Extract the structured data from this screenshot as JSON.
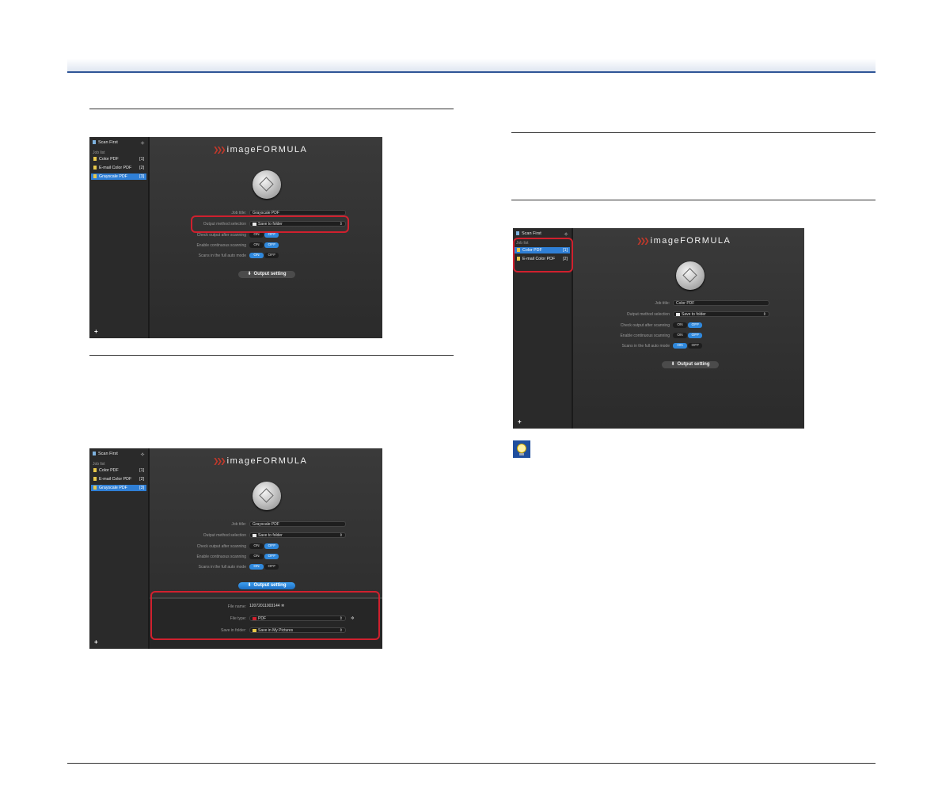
{
  "shots": [
    {
      "id": "s1",
      "scan_first": "Scan First",
      "job_list_caption": "Job list",
      "jobs": [
        {
          "label": "Color PDF",
          "num": "[1]",
          "selected": false
        },
        {
          "label": "E-mail Color PDF",
          "num": "[2]",
          "selected": false
        },
        {
          "label": "Grayscale PDF",
          "num": "[3]",
          "selected": true
        }
      ],
      "logo": "imageFORMULA",
      "job_title_label": "Job title:",
      "job_title_value": "Grayscale PDF",
      "output_method_label": "Output method selection",
      "output_method_value": "Save to folder",
      "check_output_label": "Check output after scanning",
      "continuous_label": "Enable continuous scanning",
      "full_auto_label": "Scans in the full auto mode",
      "on": "ON",
      "off": "OFF",
      "output_setting": "Output setting"
    },
    {
      "id": "s2",
      "scan_first": "Scan First",
      "job_list_caption": "Job list",
      "jobs": [
        {
          "label": "Color PDF",
          "num": "[1]",
          "selected": false
        },
        {
          "label": "E-mail Color PDF",
          "num": "[2]",
          "selected": false
        },
        {
          "label": "Grayscale PDF",
          "num": "[3]",
          "selected": true
        }
      ],
      "logo": "imageFORMULA",
      "job_title_label": "Job title:",
      "job_title_value": "Grayscale PDF",
      "output_method_label": "Output method selection",
      "output_method_value": "Save to folder",
      "check_output_label": "Check output after scanning",
      "continuous_label": "Enable continuous scanning",
      "full_auto_label": "Scans in the full auto mode",
      "on": "ON",
      "off": "OFF",
      "output_setting": "Output setting",
      "file_name_label": "File name:",
      "file_name_value": "12072011003144",
      "file_type_label": "File type:",
      "file_type_value": "PDF",
      "save_in_label": "Save in folder:",
      "save_in_value": "Save in My Pictures"
    },
    {
      "id": "s3",
      "scan_first": "Scan First",
      "job_list_caption": "Job list",
      "jobs": [
        {
          "label": "Color PDF",
          "num": "[1]",
          "selected": true
        },
        {
          "label": "E-mail Color PDF",
          "num": "[2]",
          "selected": false
        }
      ],
      "logo": "imageFORMULA",
      "job_title_label": "Job title:",
      "job_title_value": "Color PDF",
      "output_method_label": "Output method selection",
      "output_method_value": "Save to folder",
      "check_output_label": "Check output after scanning",
      "continuous_label": "Enable continuous scanning",
      "full_auto_label": "Scans in the full auto mode",
      "on": "ON",
      "off": "OFF",
      "output_setting": "Output setting"
    }
  ],
  "colors": {
    "header_rule": "#2f5597",
    "highlight_box": "#d0202e",
    "selection": "#2f7fd6"
  }
}
